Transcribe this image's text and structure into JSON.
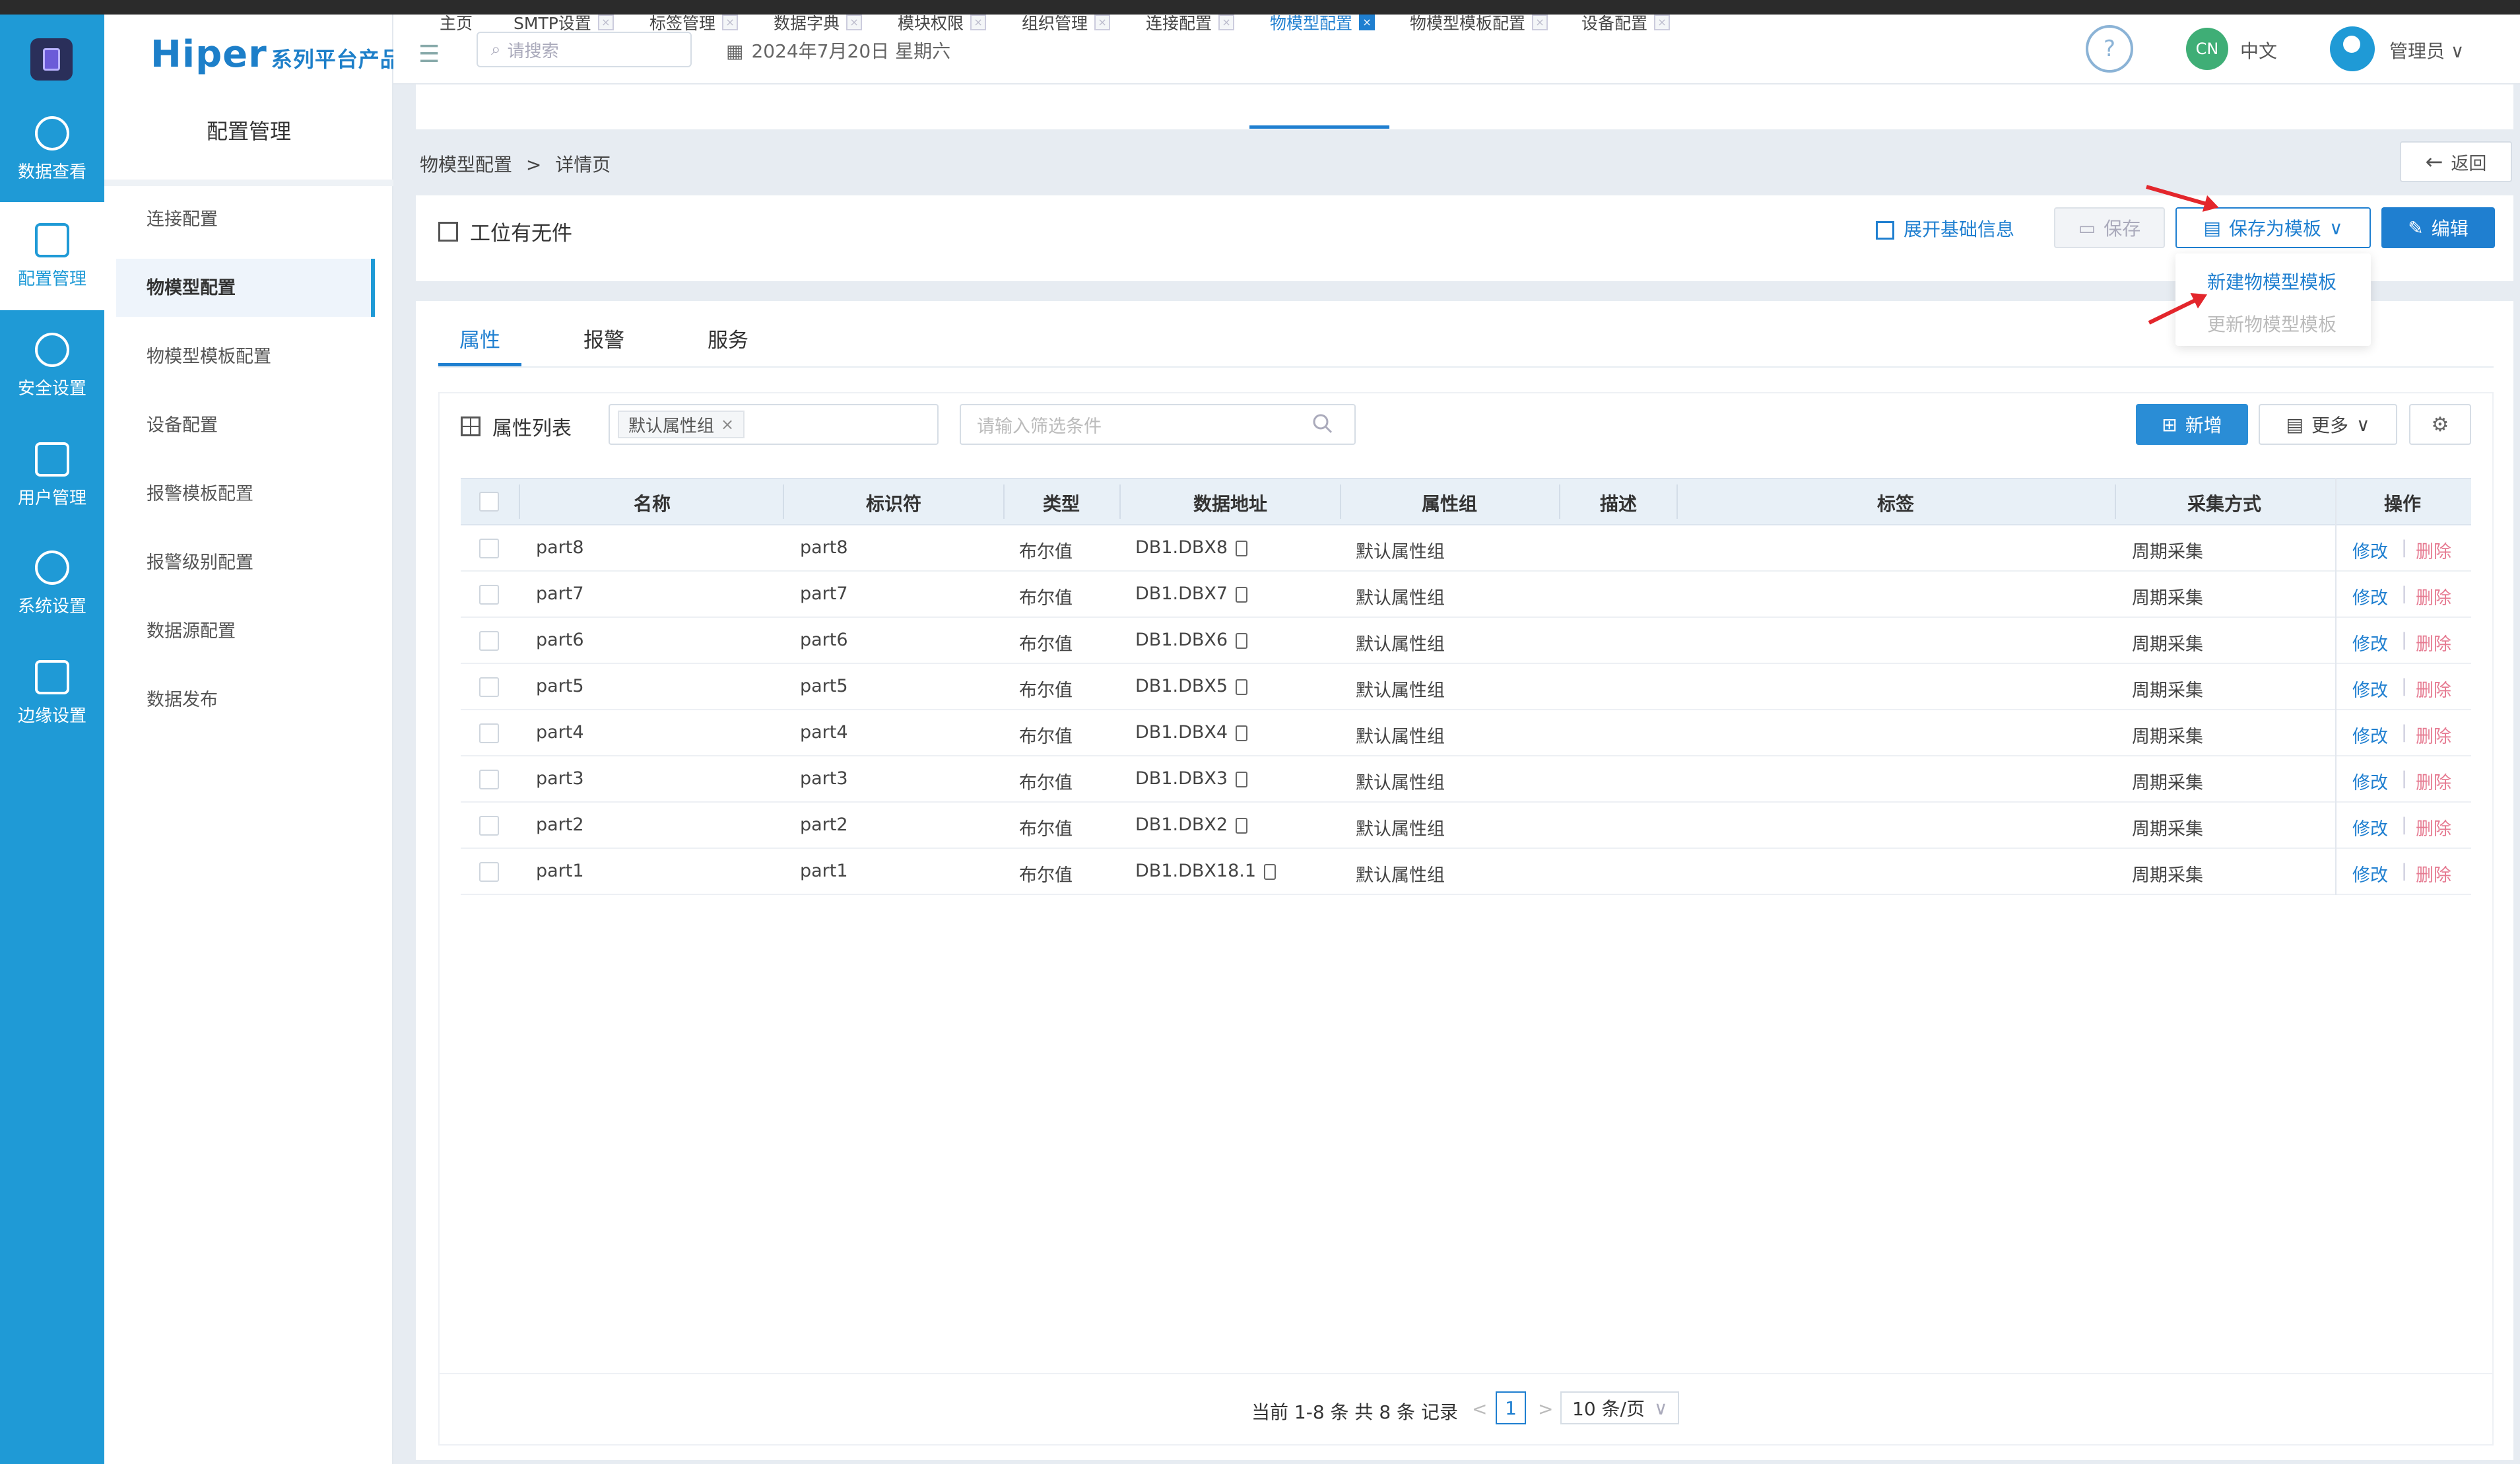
{
  "brand": {
    "name": "Hiper",
    "subtitle": "系列平台产品"
  },
  "rail": [
    {
      "label": "数据查看",
      "icon": "cube-icon"
    },
    {
      "label": "配置管理",
      "icon": "config-doc-icon"
    },
    {
      "label": "安全设置",
      "icon": "home-shield-icon"
    },
    {
      "label": "用户管理",
      "icon": "user-shield-icon"
    },
    {
      "label": "系统设置",
      "icon": "system-settings-icon"
    },
    {
      "label": "边缘设置",
      "icon": "edge-nodes-icon"
    }
  ],
  "sidebar": {
    "title": "配置管理",
    "items": [
      "连接配置",
      "物模型配置",
      "物模型模板配置",
      "设备配置",
      "报警模板配置",
      "报警级别配置",
      "数据源配置",
      "数据发布"
    ]
  },
  "header": {
    "search_placeholder": "请搜索",
    "date": "2024年7月20日 星期六",
    "lang_badge": "CN",
    "lang_text": "中文",
    "user": "管理员"
  },
  "tabs": [
    "主页",
    "SMTP设置",
    "标签管理",
    "数据字典",
    "模块权限",
    "组织管理",
    "连接配置",
    "物模型配置",
    "物模型模板配置",
    "设备配置"
  ],
  "breadcrumb": {
    "parent": "物模型配置",
    "sep": ">",
    "current": "详情页"
  },
  "back_label": "返回",
  "info": {
    "title": "工位有无件",
    "expand_label": "展开基础信息",
    "save_label": "保存",
    "saveas_label": "保存为模板",
    "edit_label": "编辑",
    "dropdown": [
      "新建物模型模板",
      "更新物模型模板"
    ]
  },
  "main_tabs": [
    "属性",
    "报警",
    "服务"
  ],
  "list": {
    "title": "属性列表",
    "group_chip": "默认属性组",
    "filter_placeholder": "请输入筛选条件",
    "add_label": "新增",
    "more_label": "更多"
  },
  "table": {
    "columns": [
      "名称",
      "标识符",
      "类型",
      "数据地址",
      "属性组",
      "描述",
      "标签",
      "采集方式",
      "操作"
    ],
    "rows": [
      {
        "name": "part8",
        "id": "part8",
        "type": "布尔值",
        "addr": "DB1.DBX8",
        "group": "默认属性组",
        "desc": "",
        "tag": "",
        "mode": "周期采集"
      },
      {
        "name": "part7",
        "id": "part7",
        "type": "布尔值",
        "addr": "DB1.DBX7",
        "group": "默认属性组",
        "desc": "",
        "tag": "",
        "mode": "周期采集"
      },
      {
        "name": "part6",
        "id": "part6",
        "type": "布尔值",
        "addr": "DB1.DBX6",
        "group": "默认属性组",
        "desc": "",
        "tag": "",
        "mode": "周期采集"
      },
      {
        "name": "part5",
        "id": "part5",
        "type": "布尔值",
        "addr": "DB1.DBX5",
        "group": "默认属性组",
        "desc": "",
        "tag": "",
        "mode": "周期采集"
      },
      {
        "name": "part4",
        "id": "part4",
        "type": "布尔值",
        "addr": "DB1.DBX4",
        "group": "默认属性组",
        "desc": "",
        "tag": "",
        "mode": "周期采集"
      },
      {
        "name": "part3",
        "id": "part3",
        "type": "布尔值",
        "addr": "DB1.DBX3",
        "group": "默认属性组",
        "desc": "",
        "tag": "",
        "mode": "周期采集"
      },
      {
        "name": "part2",
        "id": "part2",
        "type": "布尔值",
        "addr": "DB1.DBX2",
        "group": "默认属性组",
        "desc": "",
        "tag": "",
        "mode": "周期采集"
      },
      {
        "name": "part1",
        "id": "part1",
        "type": "布尔值",
        "addr": "DB1.DBX18.1",
        "group": "默认属性组",
        "desc": "",
        "tag": "",
        "mode": "周期采集"
      }
    ],
    "op_edit": "修改",
    "op_delete": "删除",
    "op_sep": "|"
  },
  "pager": {
    "summary": "当前 1-8 条 共 8 条 记录",
    "prev": "<",
    "page": "1",
    "next": ">",
    "size": "10 条/页"
  },
  "colors": {
    "rail": "#1f9ad6",
    "primary": "#1f7fd0",
    "delete": "#e67b92",
    "annotation_arrow": "#e3262c"
  }
}
